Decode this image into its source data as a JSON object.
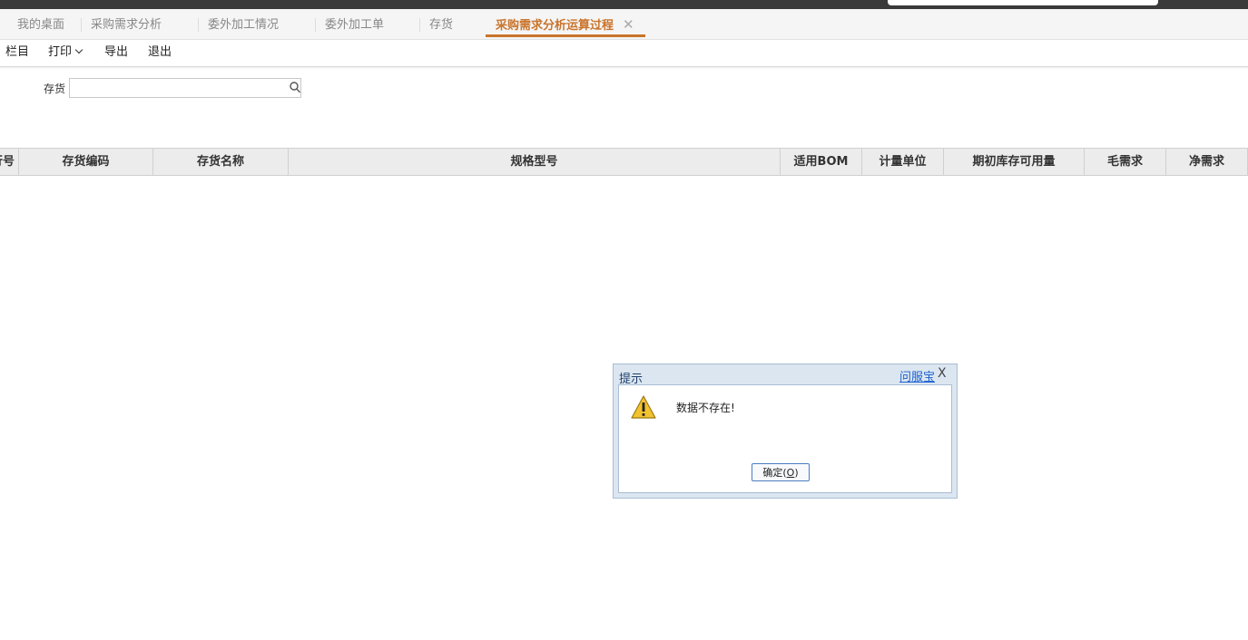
{
  "tabs": [
    {
      "label": "我的桌面",
      "active": false
    },
    {
      "label": "采购需求分析",
      "active": false
    },
    {
      "label": "委外加工情况",
      "active": false
    },
    {
      "label": "委外加工单",
      "active": false
    },
    {
      "label": "存货",
      "active": false
    },
    {
      "label": "采购需求分析运算过程",
      "active": true
    }
  ],
  "tab_close_symbol": "✕",
  "toolbar": {
    "columns_label": "栏目",
    "print_label": "打印",
    "export_label": "导出",
    "exit_label": "退出"
  },
  "filter": {
    "label": "存货",
    "value": "",
    "icon": "search-icon"
  },
  "grid": {
    "columns": [
      "行号",
      "存货编码",
      "存货名称",
      "规格型号",
      "适用BOM",
      "计量单位",
      "期初库存可用量",
      "毛需求",
      "净需求"
    ],
    "rows": []
  },
  "dialog": {
    "title": "提示",
    "help_link": "问服宝",
    "close_symbol": "X",
    "icon": "warning-icon",
    "message": "数据不存在!",
    "ok_label_prefix": "确定(",
    "ok_hotkey": "O",
    "ok_label_suffix": ")"
  },
  "colors": {
    "active_tab": "#c9742b",
    "dialog_frame": "#dbe6f1",
    "help_link": "#1a5fd0",
    "warning": "#f2c230"
  }
}
